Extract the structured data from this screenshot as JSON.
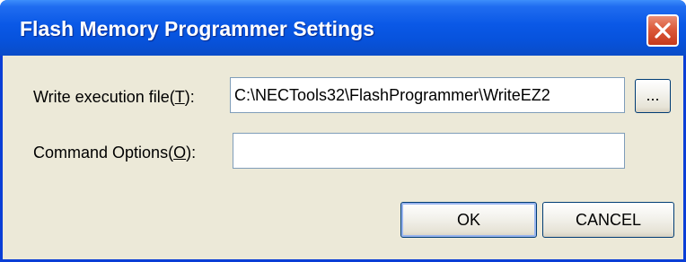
{
  "dialog": {
    "title": "Flash Memory Programmer Settings",
    "close_icon": "close-icon",
    "write_file": {
      "label_prefix": "Write execution file(",
      "label_key": "T",
      "label_suffix": "):",
      "value": "C:\\NECTools32\\FlashProgrammer\\WriteEZ2",
      "browse_label": "..."
    },
    "command_options": {
      "label_prefix": "Command Options(",
      "label_key": "O",
      "label_suffix": "):",
      "value": ""
    },
    "buttons": {
      "ok_label": "OK",
      "cancel_label": "CANCEL"
    },
    "colors": {
      "titlebar": "#0a58e6",
      "close_button": "#dc5a3a",
      "body": "#ece9d8"
    }
  }
}
